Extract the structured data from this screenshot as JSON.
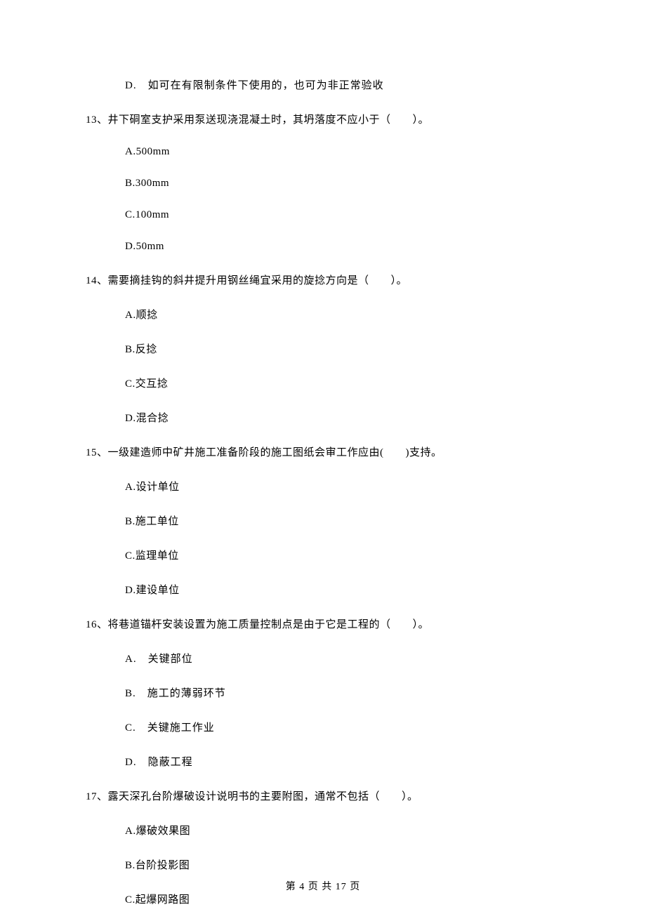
{
  "q12_d": "D.　如可在有限制条件下使用的，也可为非正常验收",
  "q13": {
    "stem": "13、井下硐室支护采用泵送现浇混凝土时，其坍落度不应小于（　　）。",
    "a": "A.500mm",
    "b": "B.300mm",
    "c": "C.100mm",
    "d": "D.50mm"
  },
  "q14": {
    "stem": "14、需要摘挂钩的斜井提升用钢丝绳宜采用的旋捻方向是（　　）。",
    "a": "A.顺捻",
    "b": "B.反捻",
    "c": "C.交互捻",
    "d": "D.混合捻"
  },
  "q15": {
    "stem": "15、一级建造师中矿井施工准备阶段的施工图纸会审工作应由(　　)支持。",
    "a": "A.设计单位",
    "b": "B.施工单位",
    "c": "C.监理单位",
    "d": "D.建设单位"
  },
  "q16": {
    "stem": "16、将巷道锚杆安装设置为施工质量控制点是由于它是工程的（　　）。",
    "a": "A.　关键部位",
    "b": "B.　施工的薄弱环节",
    "c": "C.　关键施工作业",
    "d": "D.　隐蔽工程"
  },
  "q17": {
    "stem": "17、露天深孔台阶爆破设计说明书的主要附图，通常不包括（　　）。",
    "a": "A.爆破效果图",
    "b": "B.台阶投影图",
    "c": "C.起爆网路图"
  },
  "footer": "第 4 页 共 17 页"
}
